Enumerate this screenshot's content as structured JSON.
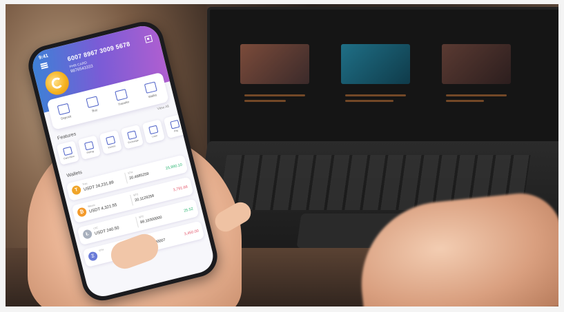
{
  "phone": {
    "status_time": "9:41",
    "card_number": "6007 8967 3009 5678",
    "account_label": "PHR CARD",
    "account_number": "9876543333",
    "actions": [
      "Deposit",
      "Buy",
      "Transfer",
      "Wallet"
    ],
    "view_all": "View All",
    "features_title": "Features",
    "features": [
      "Card Flow",
      "PhiPay",
      "Invoice",
      "Exchange",
      "Loan",
      "Pay"
    ],
    "wallets_title": "Wallets",
    "wallets": [
      {
        "coin": "Tron",
        "color": "#f0a52a",
        "symbol": "T",
        "amount": "USDT 24,231.89",
        "unit": "ETH",
        "value": "20.4685259",
        "change": "25,980.10",
        "change_color": "#2bb673"
      },
      {
        "coin": "Bitcoin",
        "color": "#f39a2b",
        "symbol": "₿",
        "amount": "USDT 4,321.55",
        "unit": "BTC",
        "value": "20.1129258",
        "change": "3,791.66",
        "change_color": "#e4566b"
      },
      {
        "coin": "LTC",
        "color": "#a8b0bd",
        "symbol": "Ł",
        "amount": "USDT 240.50",
        "unit": "BTC",
        "value": "88.19300000",
        "change": "25.52",
        "change_color": "#2bb673"
      },
      {
        "coin": "ETH",
        "color": "#6a7bd8",
        "symbol": "Ξ",
        "amount": "",
        "unit": "BTC",
        "value": "4.28000007",
        "change": "3,450.00",
        "change_color": "#e4566b"
      }
    ]
  }
}
